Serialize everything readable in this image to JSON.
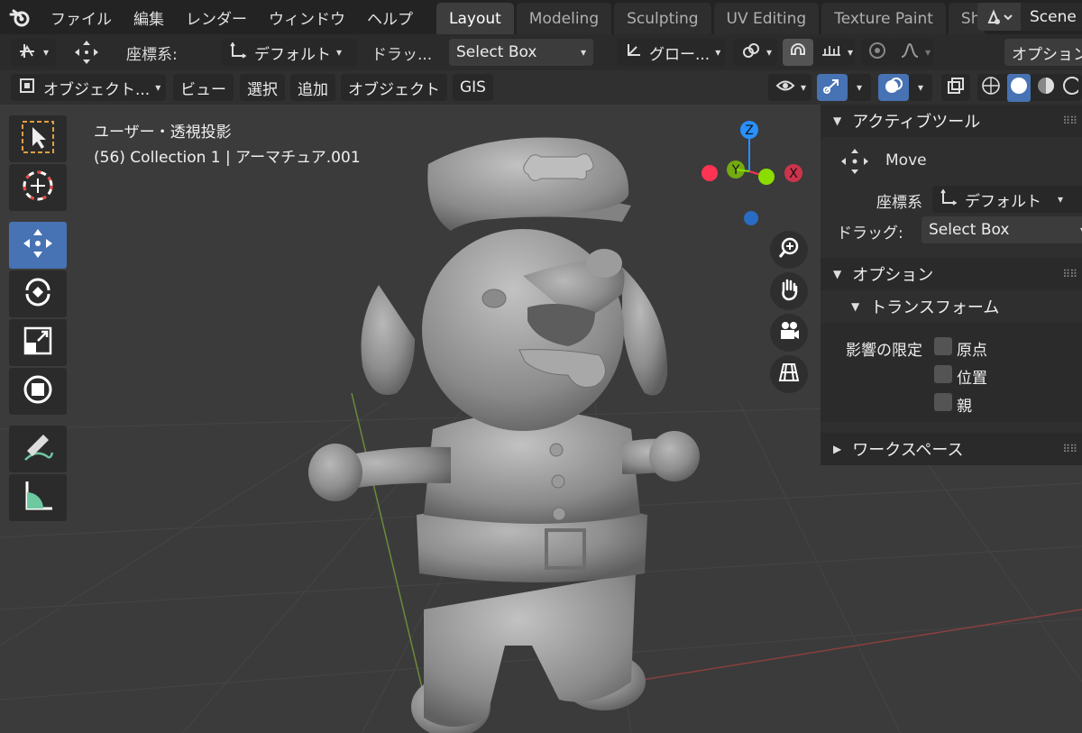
{
  "menu": [
    "ファイル",
    "編集",
    "レンダー",
    "ウィンドウ",
    "ヘルプ"
  ],
  "workspace_tabs": [
    {
      "label": "Layout",
      "active": true
    },
    {
      "label": "Modeling",
      "active": false
    },
    {
      "label": "Sculpting",
      "active": false
    },
    {
      "label": "UV Editing",
      "active": false
    },
    {
      "label": "Texture Paint",
      "active": false
    },
    {
      "label": "Sh",
      "active": false
    }
  ],
  "scene": {
    "name": "Scene"
  },
  "header_tools": {
    "orientation_label": "座標系:",
    "orientation_value": "デフォルト",
    "drag_label": "ドラッ...",
    "drag_value": "Select Box",
    "transform_orientation": "グロー...",
    "options_label": "オプション"
  },
  "viewport_header": {
    "mode": "オブジェクト...",
    "menus": [
      "ビュー",
      "選択",
      "追加",
      "オブジェクト",
      "GIS"
    ]
  },
  "viewport": {
    "view_name": "ユーザー・透視投影",
    "object_info": "(56) Collection 1 | アーマチュア.001"
  },
  "gizmo": {
    "z": "Z",
    "y": "Y",
    "x": "X"
  },
  "sidebar": {
    "active_tool_header": "アクティブツール",
    "tool_name": "Move",
    "orientation_label": "座標系",
    "orientation_value": "デフォルト",
    "drag_label": "ドラッグ:",
    "drag_value": "Select Box",
    "options_header": "オプション",
    "transform_header": "トランスフォーム",
    "affect_only_label": "影響の限定",
    "checkboxes": [
      {
        "label": "原点",
        "checked": false
      },
      {
        "label": "位置",
        "checked": false
      },
      {
        "label": "親",
        "checked": false
      }
    ],
    "workspace_header": "ワークスペース"
  },
  "colors": {
    "accent_blue": "#4772b3",
    "axis_x": "#ff3352",
    "axis_y": "#8bdc00",
    "axis_z": "#2890ff"
  }
}
